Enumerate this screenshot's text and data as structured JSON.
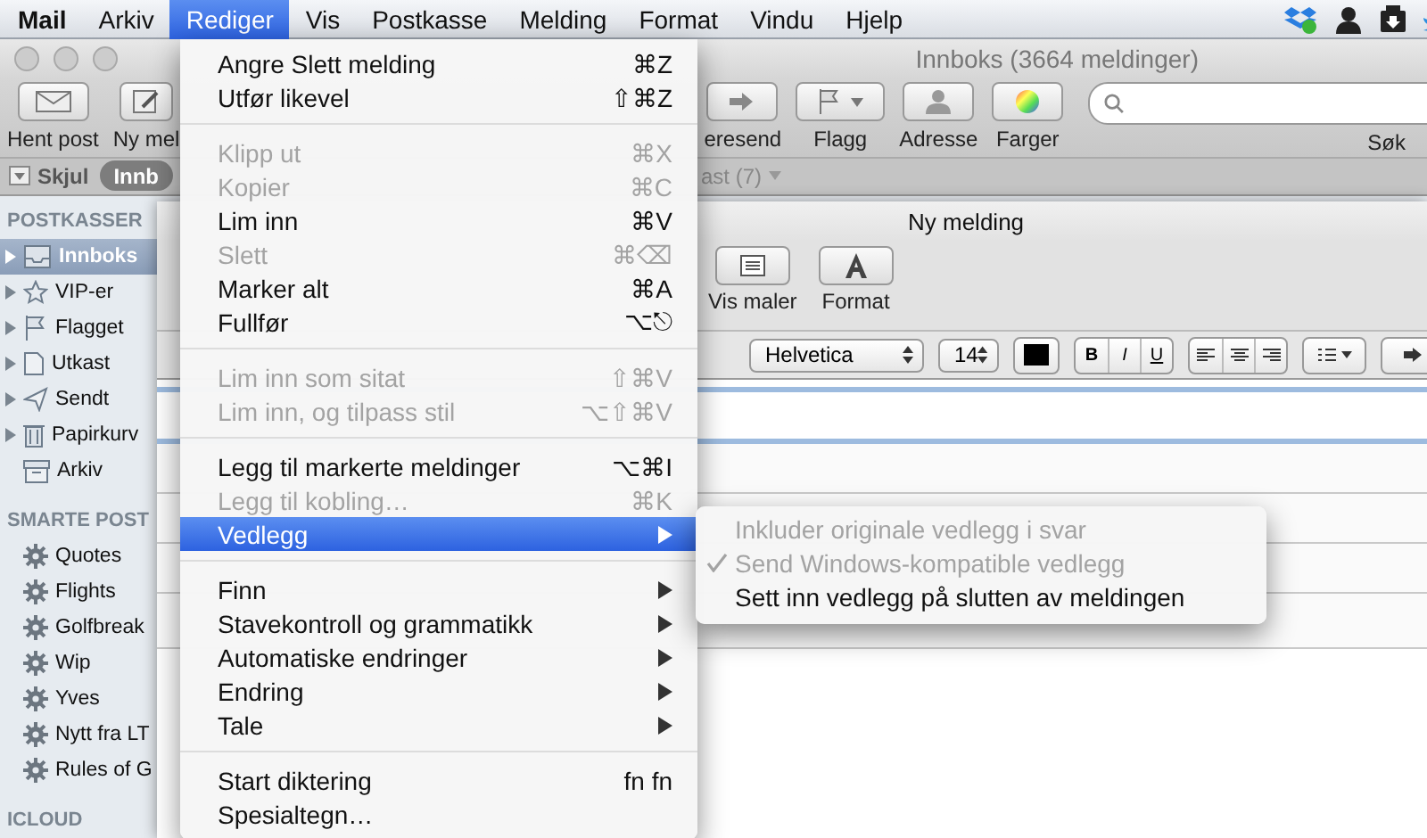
{
  "menubar": {
    "items": [
      {
        "label": "Mail",
        "kind": "app",
        "selected": false
      },
      {
        "label": "Arkiv",
        "kind": "menu",
        "selected": false
      },
      {
        "label": "Rediger",
        "kind": "menu",
        "selected": true
      },
      {
        "label": "Vis",
        "kind": "menu",
        "selected": false
      },
      {
        "label": "Postkasse",
        "kind": "menu",
        "selected": false
      },
      {
        "label": "Melding",
        "kind": "menu",
        "selected": false
      },
      {
        "label": "Format",
        "kind": "menu",
        "selected": false
      },
      {
        "label": "Vindu",
        "kind": "menu",
        "selected": false
      },
      {
        "label": "Hjelp",
        "kind": "menu",
        "selected": false
      }
    ]
  },
  "main_window": {
    "title": "Innboks (3664 meldinger)",
    "toolbar": [
      {
        "kind": "button",
        "label": "Hent post"
      },
      {
        "kind": "button",
        "label": "Ny mel"
      },
      {
        "kind": "button",
        "label": "eresend"
      },
      {
        "kind": "split",
        "label": "Flagg"
      },
      {
        "kind": "button",
        "label": "Adresse"
      },
      {
        "kind": "button",
        "label": "Farger"
      },
      {
        "kind": "search",
        "label": "Søk"
      }
    ],
    "favorites_bar": {
      "hide_button": "Skjul",
      "items": [
        {
          "label": "Innb",
          "selected": true
        },
        {
          "label": "ast (7)",
          "selected": false
        }
      ]
    },
    "sidebar": {
      "sections": [
        {
          "title": "POSTKASSER",
          "items": [
            {
              "label": "Innboks",
              "selected": true,
              "expanded": false
            },
            {
              "label": "VIP-er",
              "selected": false,
              "expanded": false
            },
            {
              "label": "Flagget",
              "selected": false,
              "expanded": false
            },
            {
              "label": "Utkast",
              "selected": false,
              "expanded": false
            },
            {
              "label": "Sendt",
              "selected": false,
              "expanded": false
            },
            {
              "label": "Papirkurv",
              "selected": false,
              "expanded": false
            },
            {
              "label": "Arkiv",
              "selected": false
            }
          ]
        },
        {
          "title": "SMARTE POST",
          "items": [
            {
              "label": "Quotes",
              "selected": false
            },
            {
              "label": "Flights",
              "selected": false
            },
            {
              "label": "Golfbreak",
              "selected": false
            },
            {
              "label": "Wip",
              "selected": false
            },
            {
              "label": "Yves",
              "selected": false
            },
            {
              "label": "Nytt fra LT",
              "selected": false
            },
            {
              "label": "Rules of G",
              "selected": false
            }
          ]
        },
        {
          "title": "ICLOUD"
        }
      ]
    }
  },
  "compose_window": {
    "title": "Ny melding",
    "toolbar": [
      {
        "label": "Vis maler"
      },
      {
        "label": "Format"
      }
    ],
    "format_bar": {
      "font": "Helvetica",
      "size": "14",
      "style_buttons": [
        "B",
        "I",
        "U"
      ]
    }
  },
  "edit_menu": {
    "groups": [
      [
        {
          "label": "Angre Slett melding",
          "shortcut": "⌘Z",
          "kind": "shortcut",
          "disabled": false,
          "selected": false
        },
        {
          "label": "Utfør likevel",
          "shortcut": "⇧⌘Z",
          "kind": "shortcut",
          "disabled": false,
          "selected": false
        }
      ],
      [
        {
          "label": "Klipp ut",
          "shortcut": "⌘X",
          "kind": "shortcut",
          "disabled": true,
          "selected": false
        },
        {
          "label": "Kopier",
          "shortcut": "⌘C",
          "kind": "shortcut",
          "disabled": true,
          "selected": false
        },
        {
          "label": "Lim inn",
          "shortcut": "⌘V",
          "kind": "shortcut",
          "disabled": false,
          "selected": false
        },
        {
          "label": "Slett",
          "shortcut": "⌘⌫",
          "kind": "shortcut",
          "disabled": true,
          "selected": false
        },
        {
          "label": "Marker alt",
          "shortcut": "⌘A",
          "kind": "shortcut",
          "disabled": false,
          "selected": false
        },
        {
          "label": "Fullfør",
          "shortcut": "⌥⎋",
          "kind": "shortcut",
          "disabled": false,
          "selected": false
        }
      ],
      [
        {
          "label": "Lim inn som sitat",
          "shortcut": "⇧⌘V",
          "kind": "shortcut",
          "disabled": true,
          "selected": false
        },
        {
          "label": "Lim inn, og tilpass stil",
          "shortcut": "⌥⇧⌘V",
          "kind": "shortcut",
          "disabled": true,
          "selected": false
        }
      ],
      [
        {
          "label": "Legg til markerte meldinger",
          "shortcut": "⌥⌘I",
          "kind": "shortcut",
          "disabled": false,
          "selected": false
        },
        {
          "label": "Legg til kobling…",
          "shortcut": "⌘K",
          "kind": "shortcut",
          "disabled": true,
          "selected": false
        },
        {
          "label": "Vedlegg",
          "kind": "submenu",
          "disabled": false,
          "selected": true
        }
      ],
      [
        {
          "label": "Finn",
          "kind": "submenu",
          "disabled": false,
          "selected": false
        },
        {
          "label": "Stavekontroll og grammatikk",
          "kind": "submenu",
          "disabled": false,
          "selected": false
        },
        {
          "label": "Automatiske endringer",
          "kind": "submenu",
          "disabled": false,
          "selected": false
        },
        {
          "label": "Endring",
          "kind": "submenu",
          "disabled": false,
          "selected": false
        },
        {
          "label": "Tale",
          "kind": "submenu",
          "disabled": false,
          "selected": false
        }
      ],
      [
        {
          "label": "Start diktering",
          "shortcut": "fn fn",
          "kind": "shortcut",
          "disabled": false,
          "selected": false
        },
        {
          "label": "Spesialtegn…",
          "kind": "plain",
          "disabled": false,
          "selected": false
        }
      ]
    ]
  },
  "attachment_submenu": {
    "items": [
      {
        "label": "Inkluder originale vedlegg i svar",
        "disabled": true,
        "checked": false
      },
      {
        "label": "Send Windows-kompatible vedlegg",
        "disabled": true,
        "checked": true
      },
      {
        "label": "Sett inn vedlegg på slutten av meldingen",
        "disabled": false,
        "checked": false
      }
    ]
  }
}
